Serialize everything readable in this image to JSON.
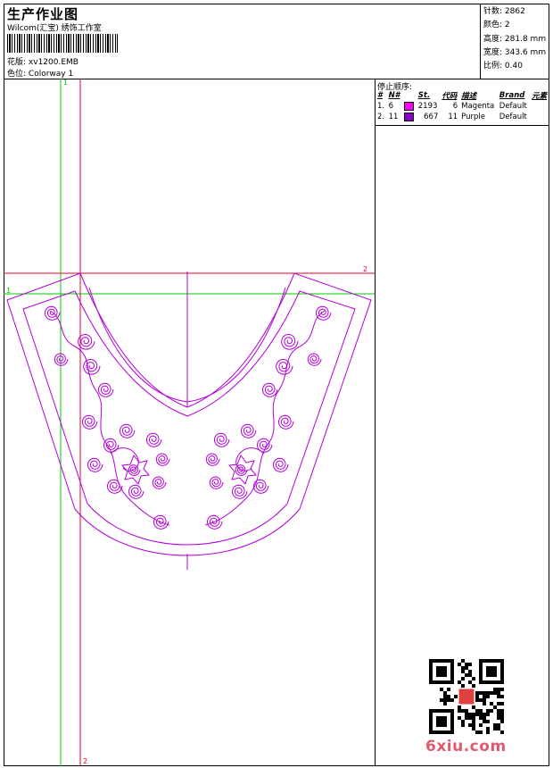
{
  "header": {
    "title": "生产作业图",
    "company": "Wilcom(汇宝) 绣饰工作室",
    "design_label": "花版:",
    "design_value": "xv1200.EMB",
    "colorway_label": "色位:",
    "colorway_value": "Colorway 1"
  },
  "stats": [
    {
      "label": "针数:",
      "value": "2862"
    },
    {
      "label": "颜色:",
      "value": "2"
    },
    {
      "label": "高度:",
      "value": "281.8 mm"
    },
    {
      "label": "宽度:",
      "value": "343.6 mm"
    },
    {
      "label": "比例:",
      "value": "0.40"
    }
  ],
  "stop_sequence": {
    "title": "停止顺序:",
    "columns": [
      "#",
      "N#",
      "St.",
      "代码",
      "描述",
      "Brand",
      "元素"
    ],
    "rows": [
      {
        "index": "1.",
        "needle": "6",
        "color": "#ff00ff",
        "stitches": "2193",
        "code": "6",
        "description": "Magenta",
        "brand": "Default"
      },
      {
        "index": "2.",
        "needle": "11",
        "color": "#8a00c8",
        "stitches": "667",
        "code": "11",
        "description": "Purple",
        "brand": "Default"
      }
    ]
  },
  "guides": {
    "green_label_top": "1",
    "green_label_left": "1",
    "red_label_right": "2",
    "red_label_bottom": "2",
    "green_color": "#00cc00",
    "red_color": "#e0002a"
  },
  "design_color": "#b400d8",
  "watermark": "6xiu.com"
}
